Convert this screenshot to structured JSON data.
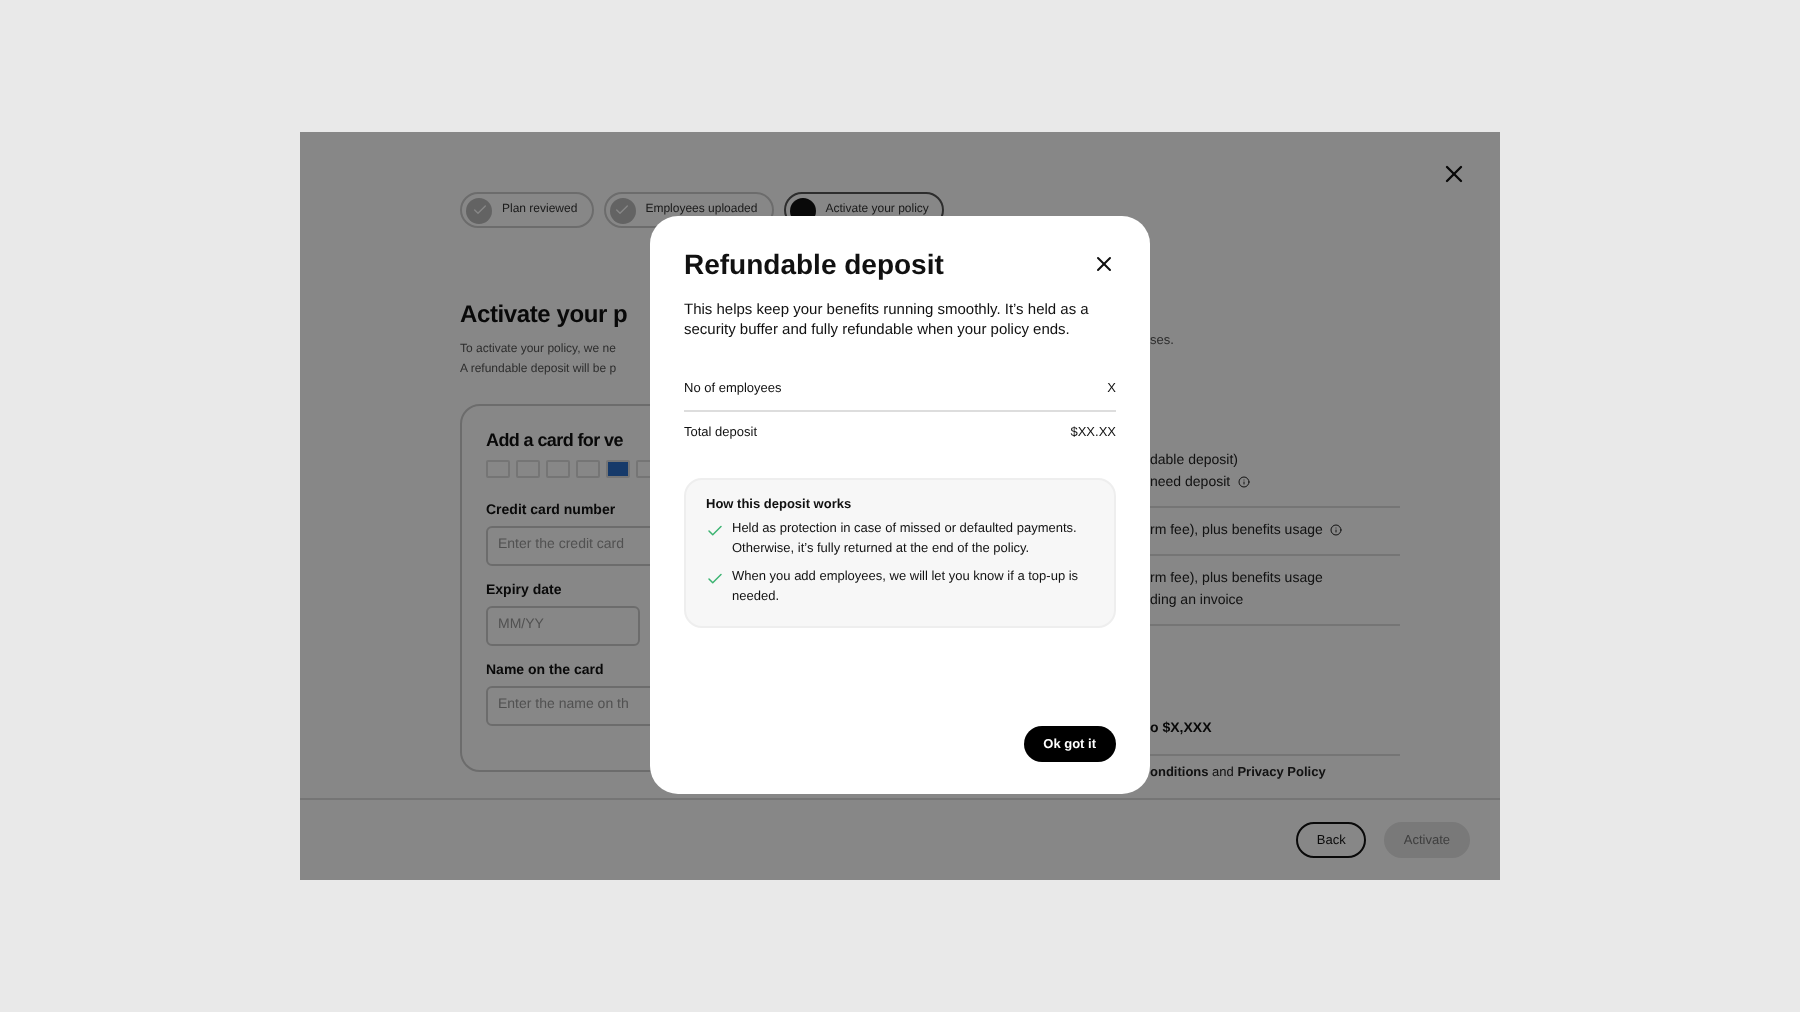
{
  "stepper": [
    {
      "label": "Plan reviewed",
      "kind": "done"
    },
    {
      "label": "Employees uploaded",
      "kind": "done"
    },
    {
      "label": "Activate your policy",
      "kind": "current"
    }
  ],
  "heading": "Activate your p",
  "intro": [
    "To activate your policy, we ne",
    "A refundable deposit will be p"
  ],
  "intro_tail": "ses.",
  "card_form": {
    "title": "Add a card for ve",
    "fields": [
      {
        "label": "Credit card number",
        "placeholder": "Enter the credit card",
        "wide": true
      },
      {
        "label": "Expiry date",
        "placeholder": "MM/YY",
        "wide": false
      },
      {
        "label": "Name on the card",
        "placeholder": "Enter the name on th",
        "wide": true
      }
    ]
  },
  "summary": [
    {
      "lines": [
        {
          "text": "dable deposit)",
          "info": false
        },
        {
          "text": "need deposit",
          "info": true
        }
      ]
    },
    {
      "lines": [
        {
          "text": "rm fee), plus benefits usage",
          "info": true
        }
      ]
    },
    {
      "lines": [
        {
          "text": "rm fee), plus benefits usage",
          "info": false
        },
        {
          "text": "ding an invoice",
          "info": false
        }
      ]
    }
  ],
  "total": "o $X,XXX",
  "terms": "**onditions** and **Privacy Policy**",
  "footer_buttons": [
    {
      "label": "Back",
      "disabled": false
    },
    {
      "label": "Activate",
      "disabled": true
    }
  ],
  "modal": {
    "title": "Refundable deposit",
    "description": "This helps keep your benefits running smoothly. It’s held as a security buffer and fully refundable when your policy ends.",
    "rows": [
      {
        "label": "No of employees",
        "value": "X"
      },
      {
        "label": "Total deposit",
        "value": "$XX.XX"
      }
    ],
    "info_title": "How this deposit works",
    "points": [
      "Held as protection in case of missed or defaulted payments. Otherwise, it’s fully returned at the end of the policy.",
      "When you add employees, we will let you know if a top-up is needed."
    ],
    "button": "Ok got it"
  }
}
